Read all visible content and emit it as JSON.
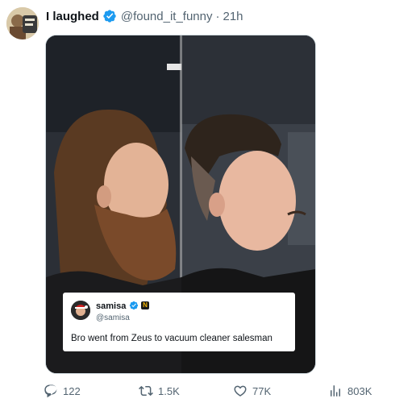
{
  "tweet": {
    "display_name": "I laughed",
    "handle": "@found_it_funny",
    "separator": "·",
    "time": "21h"
  },
  "quote": {
    "name": "samisa",
    "handle": "@samisa",
    "text": "Bro went from Zeus to vacuum cleaner salesman",
    "badge_letter": "N"
  },
  "actions": {
    "replies": "122",
    "reposts": "1.5K",
    "likes": "77K",
    "views": "803K"
  },
  "colors": {
    "verified": "#1d9bf0",
    "muted": "#536471"
  },
  "icons": [
    "verified-badge-icon",
    "reply-icon",
    "repost-icon",
    "like-icon",
    "views-icon"
  ]
}
